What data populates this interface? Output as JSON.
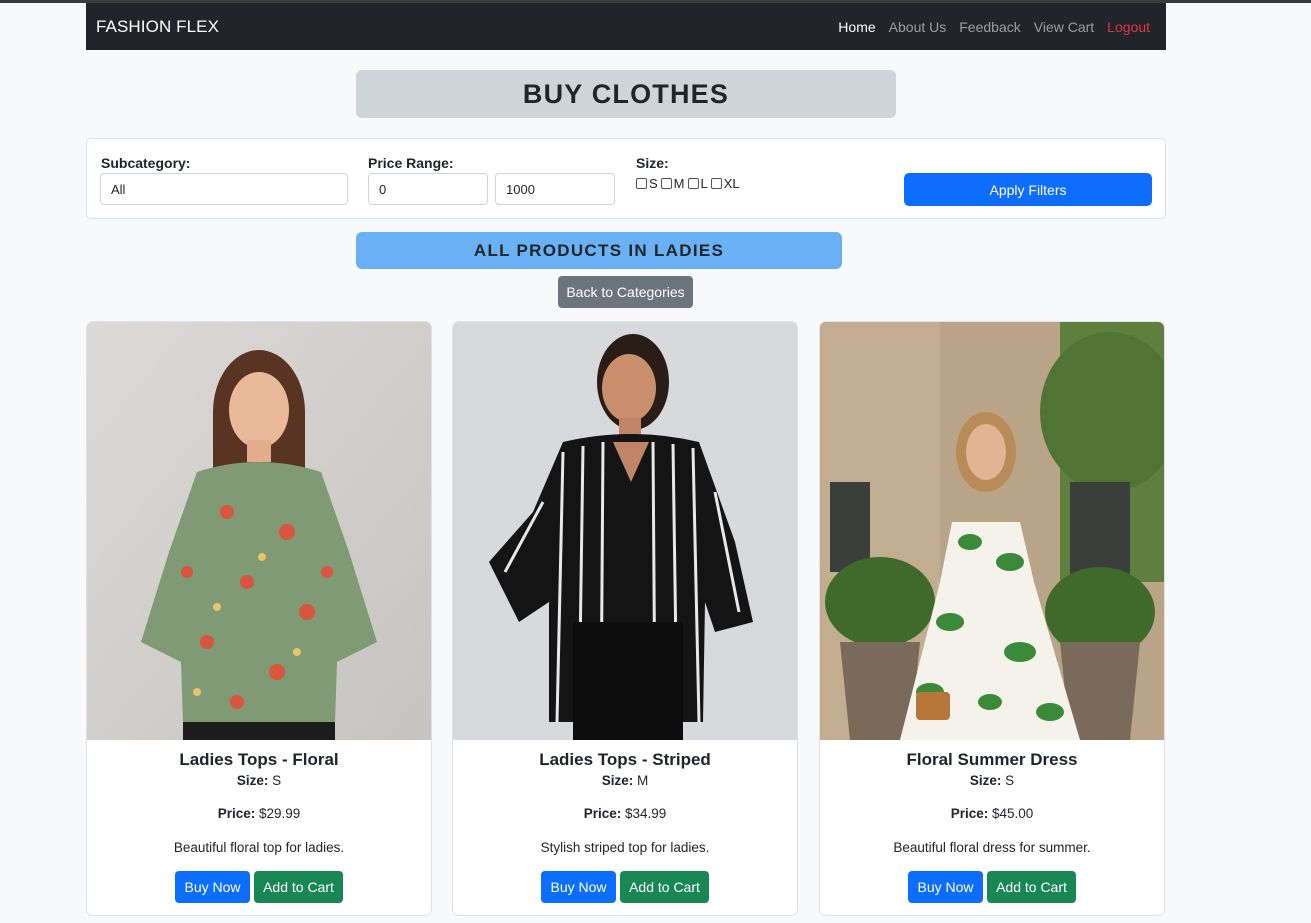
{
  "navbar": {
    "brand": "FASHION FLEX",
    "links": [
      {
        "label": "Home"
      },
      {
        "label": "About Us"
      },
      {
        "label": "Feedback"
      },
      {
        "label": "View Cart"
      },
      {
        "label": "Logout"
      }
    ]
  },
  "page_title": "BUY CLOTHES",
  "filters": {
    "subcategory_label": "Subcategory:",
    "subcategory_value": "All",
    "price_label": "Price Range:",
    "price_min": "0",
    "price_max": "1000",
    "size_label": "Size:",
    "sizes": [
      "S",
      "M",
      "L",
      "XL"
    ],
    "apply_label": "Apply Filters"
  },
  "products_heading": "ALL PRODUCTS IN LADIES",
  "back_label": "Back to Categories",
  "products": [
    {
      "name": "Ladies Tops - Floral",
      "size_label": "Size:",
      "size": "S",
      "price_label": "Price:",
      "price": "$29.99",
      "description": "Beautiful floral top for ladies.",
      "buy_label": "Buy Now",
      "cart_label": "Add to Cart"
    },
    {
      "name": "Ladies Tops - Striped",
      "size_label": "Size:",
      "size": "M",
      "price_label": "Price:",
      "price": "$34.99",
      "description": "Stylish striped top for ladies.",
      "buy_label": "Buy Now",
      "cart_label": "Add to Cart"
    },
    {
      "name": "Floral Summer Dress",
      "size_label": "Size:",
      "size": "S",
      "price_label": "Price:",
      "price": "$45.00",
      "description": "Beautiful floral dress for summer.",
      "buy_label": "Buy Now",
      "cart_label": "Add to Cart"
    }
  ],
  "colors": {
    "navbar_bg": "#212529",
    "primary": "#0d6efd",
    "success": "#198754",
    "secondary": "#6c757d",
    "danger": "#dc3545",
    "heading_blue": "#6ab0f5",
    "title_gray": "#ced4da"
  }
}
